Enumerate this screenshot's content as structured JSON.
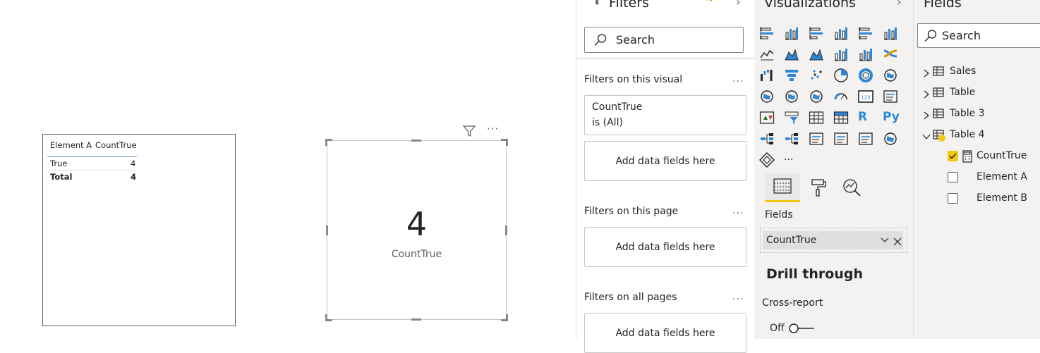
{
  "table_visual": {
    "headers": [
      "Element A",
      "CountTrue"
    ],
    "rows": [
      {
        "label": "True",
        "value": "4"
      }
    ],
    "total": {
      "label": "Total",
      "value": "4"
    }
  },
  "card_visual": {
    "value": "4",
    "label": "CountTrue"
  },
  "filters": {
    "title": "Filters",
    "search_placeholder": "Search",
    "on_visual": "Filters on this visual",
    "visual_filter": {
      "field": "CountTrue",
      "condition": "is (All)"
    },
    "add_fields": "Add data fields here",
    "on_page": "Filters on this page",
    "on_all_pages": "Filters on all pages",
    "more": "..."
  },
  "visualizations": {
    "title": "Visualizations",
    "icons": [
      "stacked-bar-chart-icon",
      "stacked-column-chart-icon",
      "clustered-bar-chart-icon",
      "clustered-column-chart-icon",
      "100-stacked-bar-chart-icon",
      "100-stacked-column-chart-icon",
      "line-chart-icon",
      "area-chart-icon",
      "stacked-area-chart-icon",
      "line-and-stacked-column-chart-icon",
      "line-and-clustered-column-chart-icon",
      "ribbon-chart-icon",
      "waterfall-chart-icon",
      "funnel-chart-icon",
      "scatter-chart-icon",
      "pie-chart-icon",
      "donut-chart-icon",
      "treemap-icon",
      "map-icon",
      "filled-map-icon",
      "shape-map-icon",
      "gauge-icon",
      "card-icon",
      "multi-row-card-icon",
      "kpi-icon",
      "slicer-icon",
      "table-icon",
      "matrix-icon",
      "r-script-visual-icon",
      "python-visual-icon",
      "key-influencers-icon",
      "decomposition-tree-icon",
      "qa-icon",
      "smart-narrative-icon",
      "paginated-report-icon",
      "arcgis-map-icon",
      "power-apps-icon",
      "more-visuals-icon"
    ],
    "fields_label": "Fields",
    "field_chip": "CountTrue",
    "drill_through": "Drill through",
    "cross_report": "Cross-report",
    "toggle_state": "Off"
  },
  "fields": {
    "title": "Fields",
    "search_placeholder": "Search",
    "tables": [
      {
        "name": "Sales",
        "expanded": false
      },
      {
        "name": "Table",
        "expanded": false
      },
      {
        "name": "Table 3",
        "expanded": false
      },
      {
        "name": "Table 4",
        "expanded": true
      }
    ],
    "table4_fields": [
      {
        "name": "CountTrue",
        "checked": true
      },
      {
        "name": "Element A",
        "checked": false
      },
      {
        "name": "Element B",
        "checked": false
      }
    ]
  },
  "colors": {
    "accent_yellow": "#f2c811",
    "viz_blue": "#2b88d8",
    "text": "#252423"
  }
}
